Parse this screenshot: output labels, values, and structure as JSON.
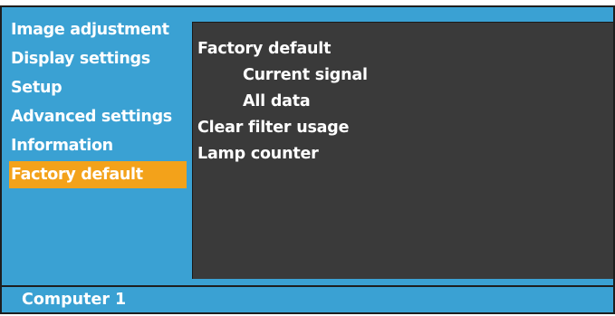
{
  "sidebar": {
    "items": [
      {
        "label": "Image adjustment"
      },
      {
        "label": "Display settings"
      },
      {
        "label": "Setup"
      },
      {
        "label": "Advanced settings"
      },
      {
        "label": "Information"
      },
      {
        "label": "Factory default",
        "selected": true
      }
    ]
  },
  "content": {
    "items": [
      {
        "label": "Factory default"
      },
      {
        "label": "Current signal"
      },
      {
        "label": "All data"
      },
      {
        "label": "Clear filter usage"
      },
      {
        "label": "Lamp counter"
      }
    ]
  },
  "status": {
    "source": "Computer 1"
  },
  "colors": {
    "menu_background": "#3aa1d3",
    "content_background": "#3a3a3a",
    "selected_item": "#f3a21a",
    "frame": "#1e1e1e",
    "text": "#ffffff"
  }
}
